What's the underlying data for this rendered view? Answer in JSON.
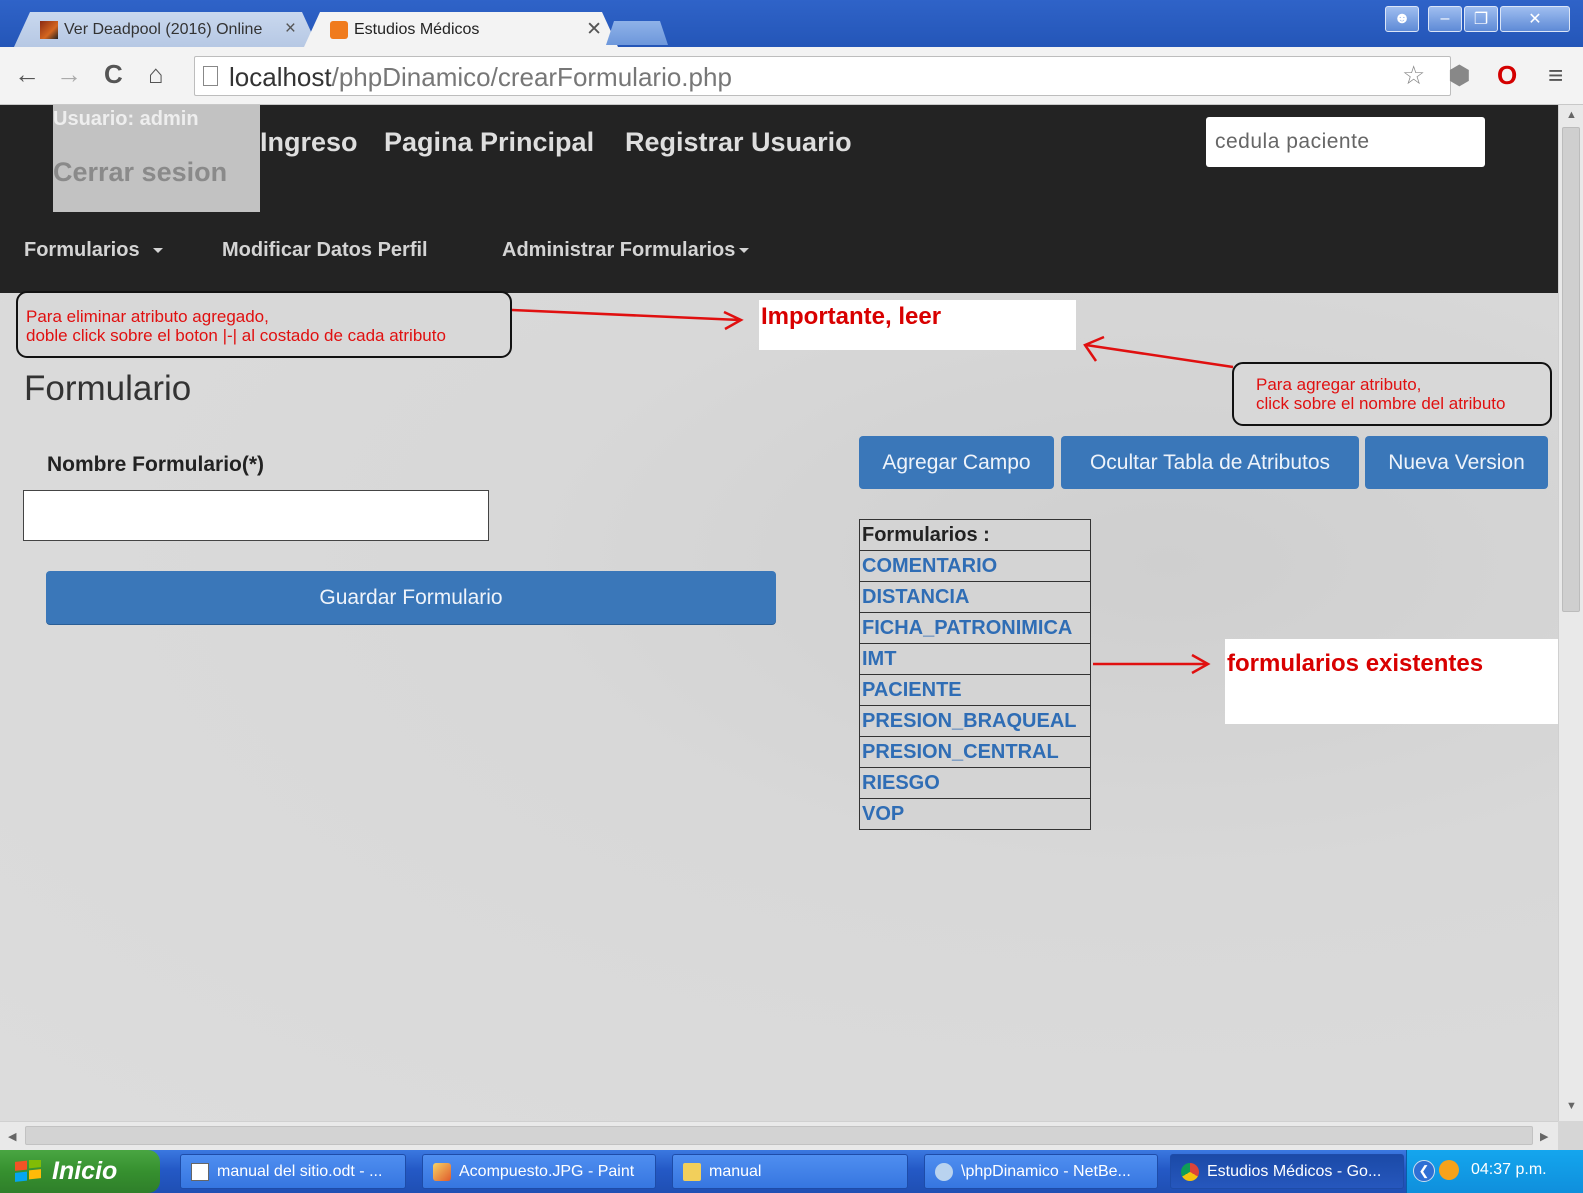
{
  "browser": {
    "tabs": [
      {
        "title": "Ver Deadpool (2016) Online"
      },
      {
        "title": "Estudios Médicos"
      }
    ],
    "url_host": "localhost",
    "url_path": "/phpDinamico/crearFormulario.php"
  },
  "header": {
    "user_label": "Usuario: admin",
    "logout": "Cerrar sesion",
    "links": [
      "Ingreso",
      "Pagina Principal",
      "Registrar Usuario"
    ],
    "search_placeholder": "cedula paciente"
  },
  "menu": {
    "items": [
      "Formularios",
      "Modificar Datos Perfil",
      "Administrar Formularios"
    ]
  },
  "annotations": {
    "delete_note_line1": "Para eliminar atributo agregado,",
    "delete_note_line2": "doble click sobre el boton |-| al costado de cada atributo",
    "important": "Importante, leer",
    "add_note_line1": "Para agregar atributo,",
    "add_note_line2": "click sobre el nombre del atributo",
    "existing": "formularios existentes",
    "accent_color": "#e01010"
  },
  "form": {
    "title": "Formulario",
    "name_label": "Nombre Formulario(*)",
    "name_value": "",
    "save_label": "Guardar Formulario"
  },
  "actions": {
    "add_field": "Agregar Campo",
    "hide_table": "Ocultar Tabla de Atributos",
    "new_version": "Nueva Version"
  },
  "forms_table": {
    "header": "Formularios :",
    "rows": [
      "COMENTARIO",
      "DISTANCIA",
      "FICHA_PATRONIMICA",
      "IMT",
      "PACIENTE",
      "PRESION_BRAQUEAL",
      "PRESION_CENTRAL",
      "RIESGO",
      "VOP"
    ]
  },
  "taskbar": {
    "start": "Inicio",
    "tasks": [
      "manual del sitio.odt - ...",
      "Acompuesto.JPG - Paint",
      "manual",
      "\\phpDinamico - NetBe...",
      "Estudios Médicos - Go..."
    ],
    "clock": "04:37 p.m."
  }
}
